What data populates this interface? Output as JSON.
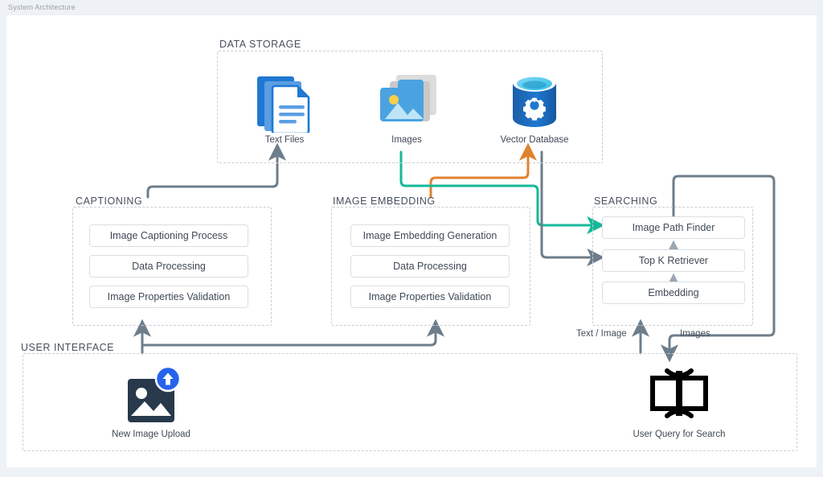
{
  "window": {
    "title": "System Architecture"
  },
  "colors": {
    "gray_wire": "#6e7d8a",
    "teal_wire": "#16b89a",
    "orange_wire": "#e0822f",
    "group_border": "#c9ced6",
    "pill_border": "#dadfe4",
    "text": "#3f4956",
    "blue_accent": "#2563eb",
    "azure_blue": "#1f6fc4",
    "image_blue": "#4aa3e0",
    "dark_slate": "#27394b"
  },
  "groups": [
    {
      "id": "data-storage",
      "label": "DATA STORAGE"
    },
    {
      "id": "captioning",
      "label": "CAPTIONING"
    },
    {
      "id": "image-embedding",
      "label": "IMAGE EMBEDDING"
    },
    {
      "id": "searching",
      "label": "SEARCHING"
    },
    {
      "id": "user-interface",
      "label": "USER INTERFACE"
    }
  ],
  "data_storage": {
    "label": "DATA STORAGE",
    "nodes": [
      {
        "id": "text-files",
        "label": "Text Files",
        "icon": "text-files-icon"
      },
      {
        "id": "images",
        "label": "Images",
        "icon": "images-icon"
      },
      {
        "id": "vector-database",
        "label": "Vector Database",
        "icon": "vector-database-icon"
      }
    ]
  },
  "captioning": {
    "label": "CAPTIONING",
    "steps": [
      {
        "label": "Image Captioning Process"
      },
      {
        "label": "Data Processing"
      },
      {
        "label": "Image Properties Validation"
      }
    ]
  },
  "image_embedding": {
    "label": "IMAGE EMBEDDING",
    "steps": [
      {
        "label": "Image Embedding Generation"
      },
      {
        "label": "Data Processing"
      },
      {
        "label": "Image Properties Validation"
      }
    ]
  },
  "searching": {
    "label": "SEARCHING",
    "steps": [
      {
        "label": "Image Path Finder"
      },
      {
        "label": "Top K Retriever"
      },
      {
        "label": "Embedding"
      }
    ]
  },
  "user_interface": {
    "label": "USER INTERFACE",
    "nodes": [
      {
        "id": "new-image-upload",
        "label": "New Image Upload",
        "icon": "image-upload-icon"
      },
      {
        "id": "user-query-for-search",
        "label": "User Query for Search",
        "icon": "query-book-icon"
      }
    ]
  },
  "edge_labels": [
    {
      "id": "text-image",
      "label": "Text / Image"
    },
    {
      "id": "images-return",
      "label": "Images"
    }
  ]
}
